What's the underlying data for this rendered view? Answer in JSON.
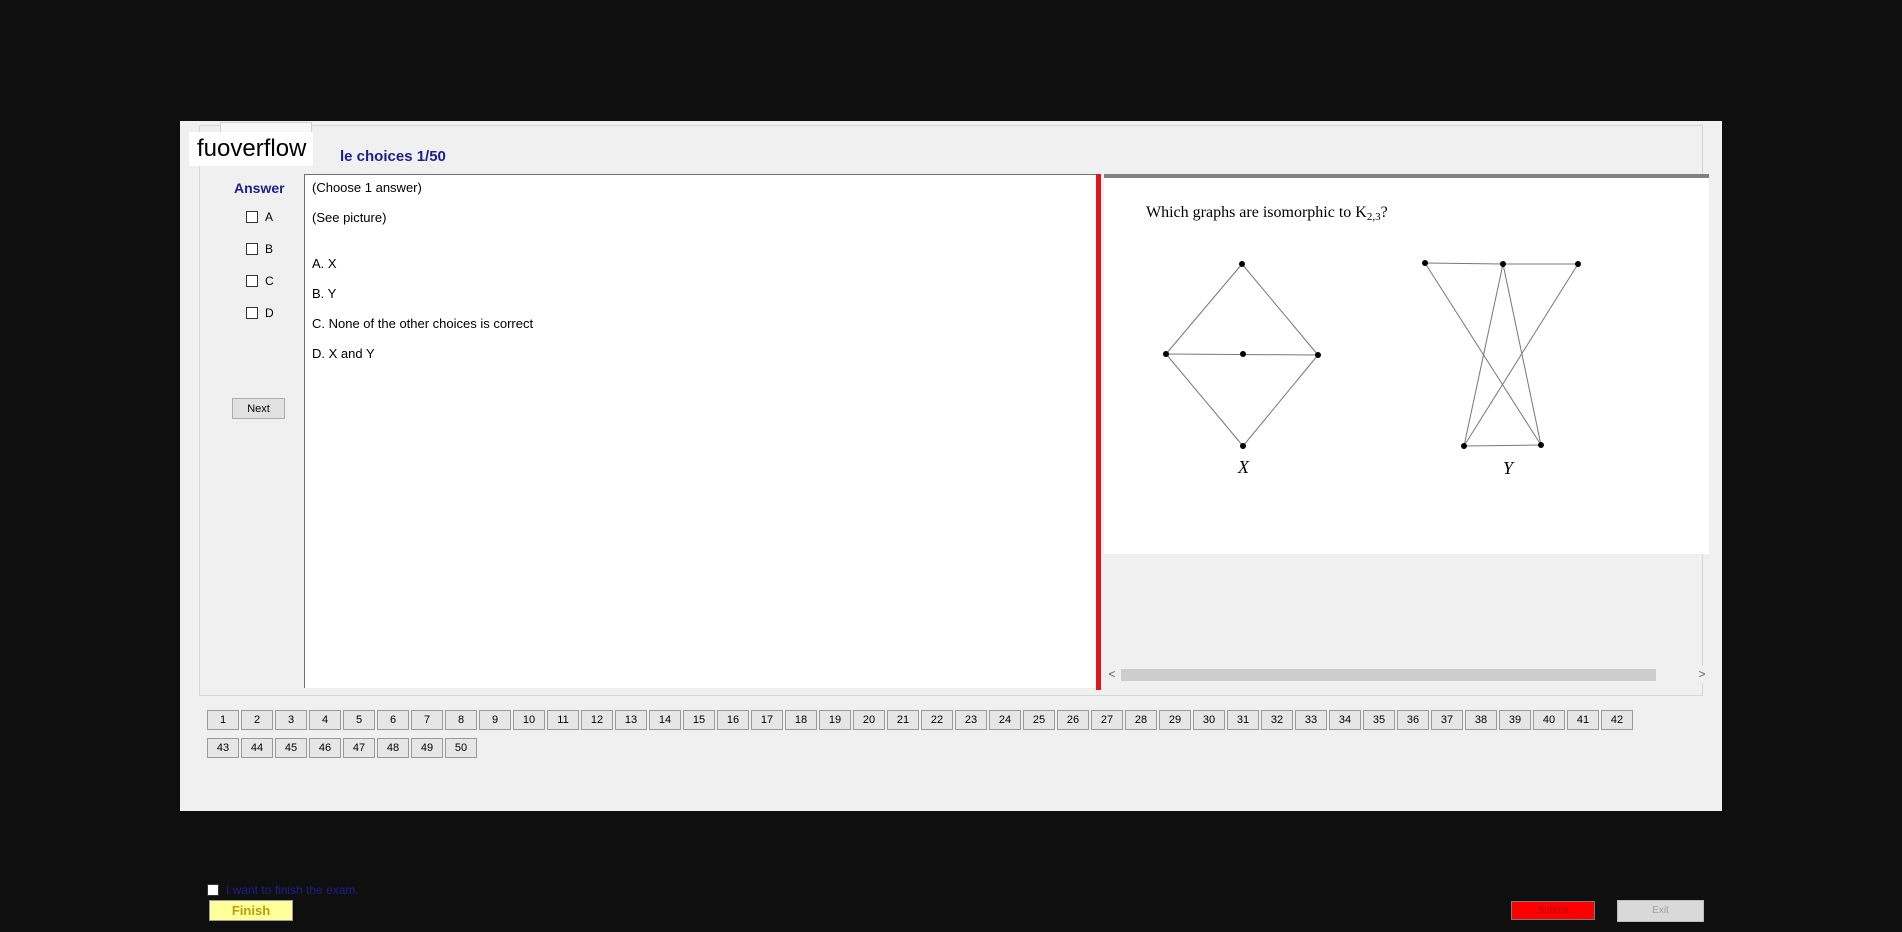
{
  "watermark": "fuoverflow",
  "title": "le choices 1/50",
  "answer_label": "Answer",
  "options": [
    "A",
    "B",
    "C",
    "D"
  ],
  "next_label": "Next",
  "question": {
    "instruction": "(Choose 1 answer)",
    "prompt": "(See picture)",
    "choices": [
      "A.  X",
      "B.  Y",
      "C.  None of the other choices is correct",
      "D.  X and Y"
    ]
  },
  "figure": {
    "question_text": "Which graphs are isomorphic to K",
    "question_sub": "2,3",
    "question_end": "?",
    "label_x": "X",
    "label_y": "Y"
  },
  "scroll": {
    "left_arrow": "<",
    "right_arrow": ">"
  },
  "question_numbers_row1": [
    "1",
    "2",
    "3",
    "4",
    "5",
    "6",
    "7",
    "8",
    "9",
    "10",
    "11",
    "12",
    "13",
    "14",
    "15",
    "16",
    "17",
    "18",
    "19",
    "20",
    "21",
    "22",
    "23",
    "24",
    "25",
    "26",
    "27",
    "28",
    "29",
    "30",
    "31",
    "32",
    "33",
    "34",
    "35",
    "36",
    "37",
    "38",
    "39",
    "40",
    "41",
    "42"
  ],
  "question_numbers_row2": [
    "43",
    "44",
    "45",
    "46",
    "47",
    "48",
    "49",
    "50"
  ],
  "finish_checkbox_label": "I want to finish the exam.",
  "finish_label": "Finish",
  "submit_label": "Submit",
  "exit_label": "Exit"
}
